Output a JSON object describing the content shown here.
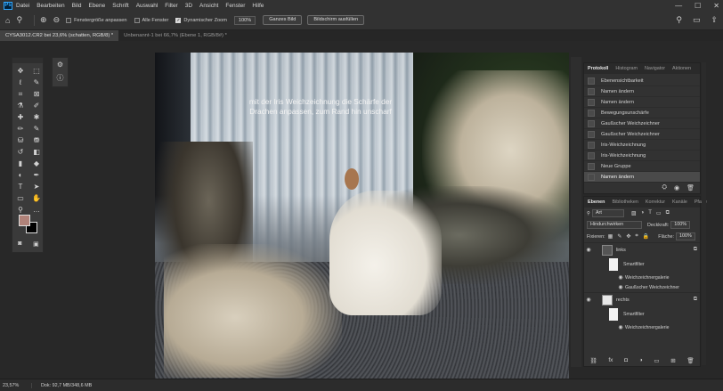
{
  "menubar": {
    "logo": "Ps",
    "items": [
      "Datei",
      "Bearbeiten",
      "Bild",
      "Ebene",
      "Schrift",
      "Auswahl",
      "Filter",
      "3D",
      "Ansicht",
      "Fenster",
      "Hilfe"
    ],
    "window_controls": [
      "—",
      "☐",
      "✕"
    ]
  },
  "options": {
    "fit_window": "Fenstergröße anpassen",
    "all_windows": "Alle Fenster",
    "scrubby_zoom": "Dynamischer Zoom",
    "zoom_value": "100%",
    "fit_screen": "Ganzes Bild",
    "fill_screen": "Bildschirm ausfüllen"
  },
  "tabs": [
    {
      "label": "CYSA3012.CR2 bei 23,6% (schatten, RGB/8) *",
      "active": true
    },
    {
      "label": "Unbenannt-1 bei 66,7% (Ebene 1, RGB/8#) *",
      "active": false
    }
  ],
  "canvas": {
    "caption_line1": "mit der Iris Weichzeichnung die Schärfe der",
    "caption_line2": "Drachen anpassen, zum Rand hin unscharf"
  },
  "history": {
    "tabs": [
      "Protokoll",
      "Histogram",
      "Navigator",
      "Aktionen"
    ],
    "items": [
      "Ebenensichtbarkeit",
      "Namen ändern",
      "Namen ändern",
      "Bewegungsunschärfe",
      "Gaußscher Weichzeichner",
      "Gaußscher Weichzeichner",
      "Iris-Weichzeichnung",
      "Iris-Weichzeichnung",
      "Neue Gruppe",
      "Namen ändern"
    ],
    "selected_index": 9
  },
  "layers": {
    "tabs": [
      "Ebenen",
      "Bibliotheken",
      "Korrektur",
      "Kanäle",
      "Pfade"
    ],
    "filter_kind": "Art",
    "blend_mode": "Hindurchwirken",
    "opacity_label": "Deckkraft:",
    "opacity_value": "100%",
    "lock_label": "Fixieren:",
    "fill_label": "Fläche:",
    "fill_value": "100%",
    "rows": [
      {
        "name": "links",
        "type": "layer"
      },
      {
        "name": "Smartfilter",
        "type": "smartfilter"
      },
      {
        "name": "Weichzeichnergalerie",
        "type": "filter"
      },
      {
        "name": "Gaußscher Weichzeichner",
        "type": "filter"
      },
      {
        "name": "rechts",
        "type": "layer"
      },
      {
        "name": "Smartfilter",
        "type": "smartfilter"
      },
      {
        "name": "Weichzeichnergalerie",
        "type": "filter"
      }
    ]
  },
  "status": {
    "zoom": "23,57%",
    "doc": "Dok: 92,7 MB/348,6 MB"
  },
  "colors": {
    "foreground": "#b08279",
    "background": "#000000",
    "ui_dark": "#282828",
    "panel": "#323232"
  }
}
